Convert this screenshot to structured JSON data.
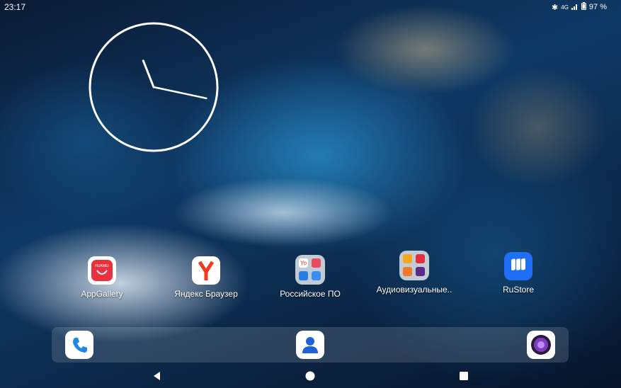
{
  "status": {
    "time": "23:17",
    "network": "4G",
    "battery": "97 %"
  },
  "apps": [
    {
      "label": "AppGallery",
      "brand": "HUAWEI",
      "icon": "appgallery-icon",
      "color": "#e8313d"
    },
    {
      "label": "Яндекс Браузер",
      "icon": "yandex-browser-icon",
      "color": "#f23a1f"
    },
    {
      "label": "Российское ПО",
      "icon": "folder-icon"
    },
    {
      "label": "Аудиовизуальные..",
      "icon": "folder-icon"
    },
    {
      "label": "RuStore",
      "icon": "rustore-icon",
      "color": "#1f6ff6"
    }
  ],
  "folder_russian_apps": [
    "Yo"
  ],
  "dock": [
    {
      "icon": "phone-icon",
      "color": "#1e88e5"
    },
    {
      "icon": "contacts-icon",
      "color": "#1e63d6"
    },
    {
      "icon": "camera-icon",
      "color": "#7a3cc0"
    }
  ],
  "clock": {
    "hours": 11,
    "minutes": 17
  }
}
